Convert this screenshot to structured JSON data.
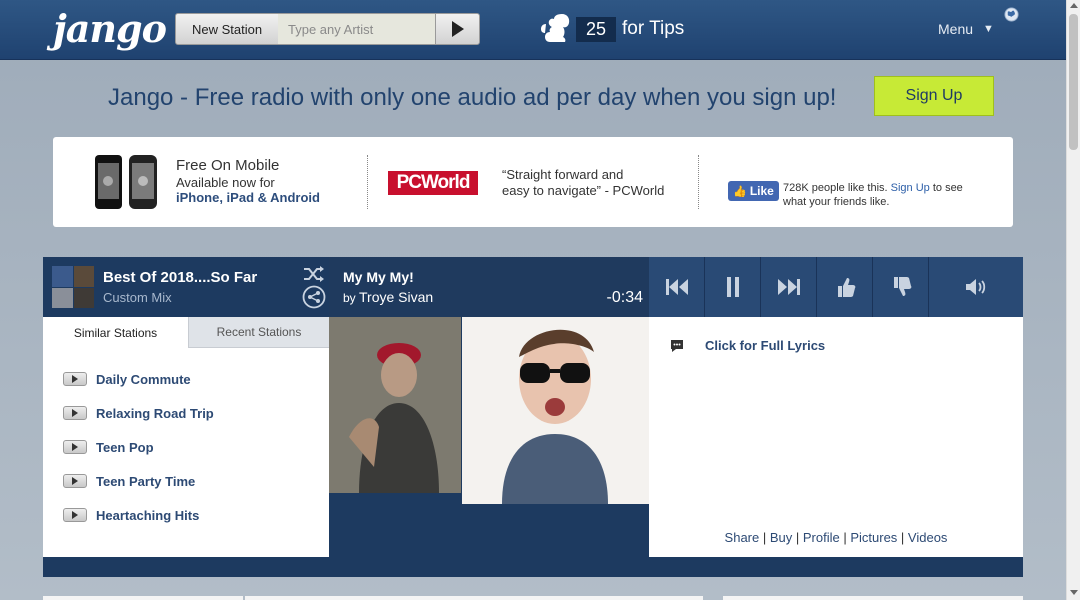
{
  "header": {
    "logo": "jango",
    "new_station_label": "New Station",
    "artist_placeholder": "Type any Artist",
    "tips_count": "25",
    "tips_label": "for Tips",
    "menu_label": "Menu",
    "menu_arrow": "▼"
  },
  "promo": {
    "text": "Jango - Free radio with only one audio ad per day when you sign up!",
    "signup_label": "Sign Up"
  },
  "info": {
    "mobile_title": "Free On Mobile",
    "mobile_sub": "Available now for",
    "mobile_platforms": "iPhone, iPad & Android",
    "pcworld_logo": "PCWorld",
    "quote_line1": "“Straight forward and",
    "quote_line2": "easy to navigate” - PCWorld",
    "fb_like": "Like",
    "fb_text_before": "728K people like this. ",
    "fb_link": "Sign Up",
    "fb_text_after": " to see what your friends like."
  },
  "player": {
    "station_title": "Best Of 2018....So Far",
    "station_sub": "Custom Mix",
    "song_title": "My My My!",
    "song_by": "by ",
    "song_artist": "Troye Sivan",
    "time_remaining": "-0:34",
    "tabs": [
      "Similar Stations",
      "Recent Stations"
    ],
    "similar_stations": [
      "Daily Commute",
      "Relaxing Road Trip",
      "Teen Pop",
      "Teen Party Time",
      "Heartaching Hits"
    ],
    "lyrics_link": "Click for Full Lyrics",
    "links": [
      "Share",
      "Buy",
      "Profile",
      "Pictures",
      "Videos"
    ],
    "link_sep": " | "
  },
  "colors": {
    "header_bg": "#1f4270",
    "player_bg": "#1d3a60",
    "signup_bg": "#c7ea36",
    "link_blue": "#2d4a74"
  }
}
